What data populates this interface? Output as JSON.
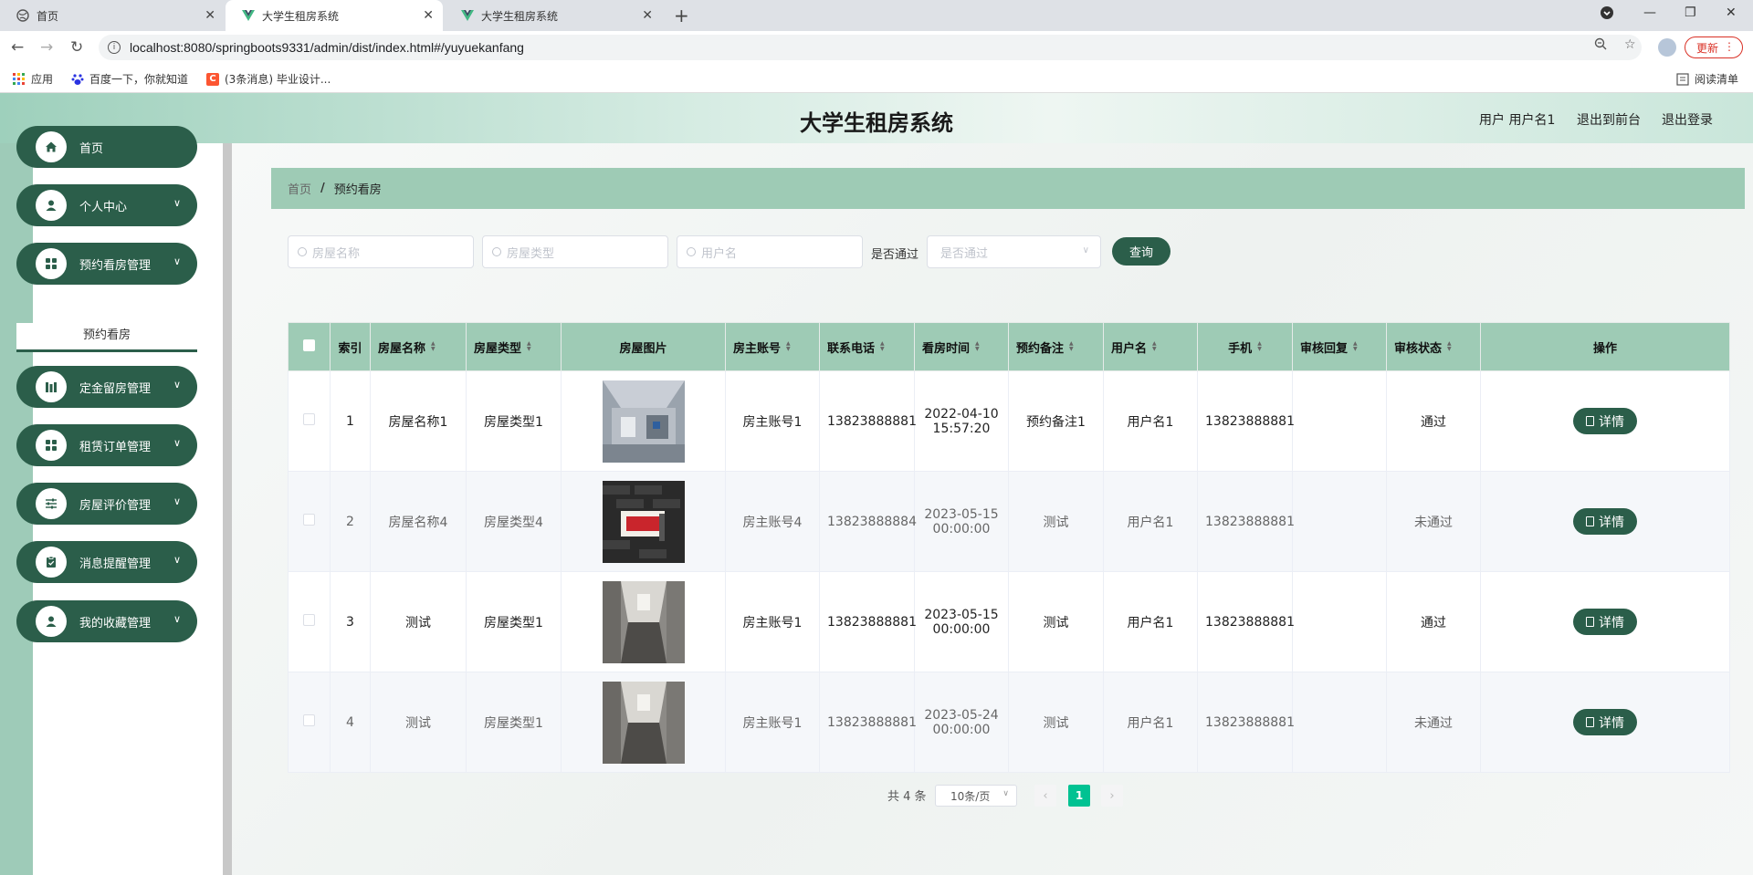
{
  "browser": {
    "tabs": [
      {
        "title": "首页"
      },
      {
        "title": "大学生租房系统"
      },
      {
        "title": "大学生租房系统"
      }
    ],
    "url": "localhost:8080/springboots9331/admin/dist/index.html#/yuyuekanfang",
    "update_label": "更新",
    "bookmarks": [
      {
        "label": "应用"
      },
      {
        "label": "百度一下，你就知道"
      },
      {
        "label": "(3条消息) 毕业设计..."
      }
    ],
    "reading_list": "阅读清单"
  },
  "header": {
    "title": "大学生租房系统",
    "user": "用户 用户名1",
    "back_front": "退出到前台",
    "logout": "退出登录"
  },
  "sidebar": {
    "items": [
      {
        "label": "首页",
        "icon": "home-icon"
      },
      {
        "label": "个人中心",
        "icon": "user-icon"
      },
      {
        "label": "预约看房管理",
        "icon": "grid-icon"
      },
      {
        "label": "定金留房管理",
        "icon": "chart-icon"
      },
      {
        "label": "租赁订单管理",
        "icon": "grid-icon"
      },
      {
        "label": "房屋评价管理",
        "icon": "sliders-icon"
      },
      {
        "label": "消息提醒管理",
        "icon": "clipboard-icon"
      },
      {
        "label": "我的收藏管理",
        "icon": "user-icon"
      }
    ],
    "submenu": "预约看房"
  },
  "breadcrumb": {
    "home": "首页",
    "sep": "/",
    "current": "预约看房"
  },
  "search": {
    "house_name_ph": "房屋名称",
    "house_type_ph": "房屋类型",
    "username_ph": "用户名",
    "approved_label": "是否通过",
    "approved_ph": "是否通过",
    "query_label": "查询"
  },
  "table": {
    "headers": {
      "index": "索引",
      "house_name": "房屋名称",
      "house_type": "房屋类型",
      "house_image": "房屋图片",
      "owner_account": "房主账号",
      "phone": "联系电话",
      "visit_time": "看房时间",
      "note": "预约备注",
      "username": "用户名",
      "mobile": "手机",
      "review_reply": "审核回复",
      "review_status": "审核状态",
      "actions": "操作"
    },
    "detail_label": "详情",
    "rows": [
      {
        "index": "1",
        "house_name": "房屋名称1",
        "house_type": "房屋类型1",
        "owner": "房主账号1",
        "phone": "13823888881",
        "visit_date": "2022-04-10",
        "visit_time": "15:57:20",
        "note": "预约备注1",
        "username": "用户名1",
        "mobile": "13823888881",
        "reply": "",
        "status": "通过"
      },
      {
        "index": "2",
        "house_name": "房屋名称4",
        "house_type": "房屋类型4",
        "owner": "房主账号4",
        "phone": "13823888884",
        "visit_date": "2023-05-15",
        "visit_time": "00:00:00",
        "note": "测试",
        "username": "用户名1",
        "mobile": "13823888881",
        "reply": "",
        "status": "未通过"
      },
      {
        "index": "3",
        "house_name": "测试",
        "house_type": "房屋类型1",
        "owner": "房主账号1",
        "phone": "13823888881",
        "visit_date": "2023-05-15",
        "visit_time": "00:00:00",
        "note": "测试",
        "username": "用户名1",
        "mobile": "13823888881",
        "reply": "",
        "status": "通过"
      },
      {
        "index": "4",
        "house_name": "测试",
        "house_type": "房屋类型1",
        "owner": "房主账号1",
        "phone": "13823888881",
        "visit_date": "2023-05-24",
        "visit_time": "00:00:00",
        "note": "测试",
        "username": "用户名1",
        "mobile": "13823888881",
        "reply": "",
        "status": "未通过"
      }
    ]
  },
  "pagination": {
    "total": "共 4 条",
    "page_size": "10条/页",
    "current_page": "1"
  },
  "colors": {
    "primary": "#2b5e4a",
    "header_green": "#9ecbb5",
    "active_page": "#00c292"
  }
}
